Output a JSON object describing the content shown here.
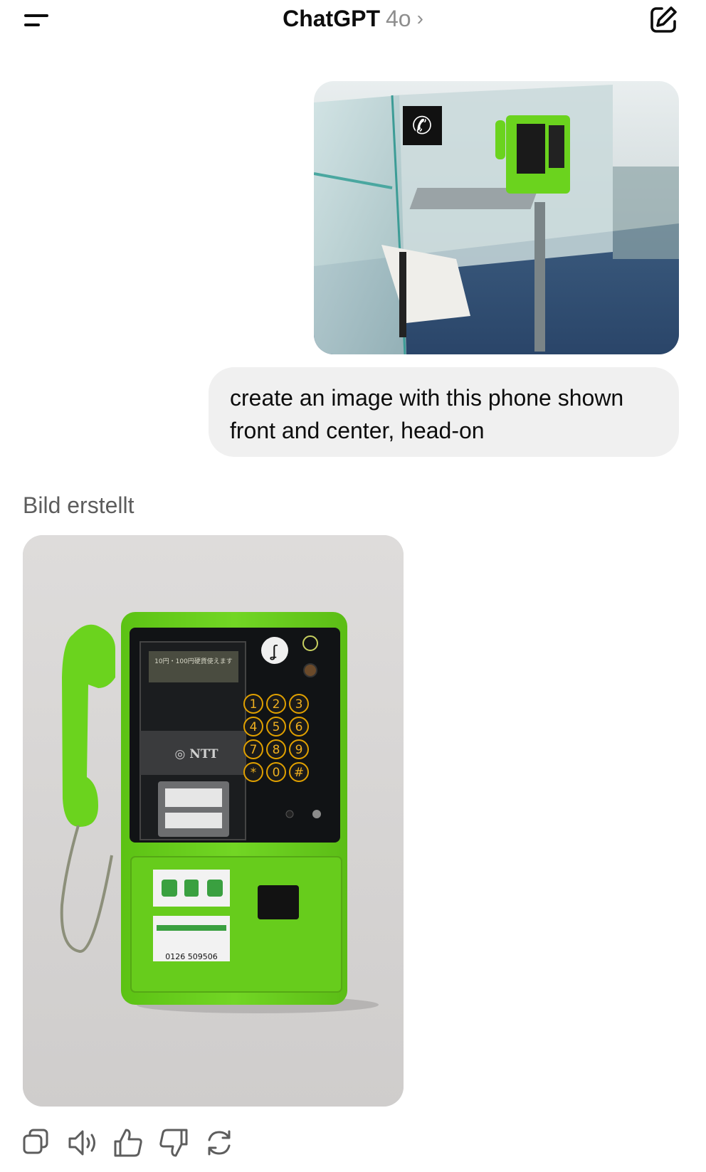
{
  "header": {
    "title": "ChatGPT",
    "model": "4o",
    "chevron": "›",
    "menu_icon": "menu-icon",
    "new_chat_icon": "new-chat-icon"
  },
  "conversation": {
    "user_image_alt_icon": "phone-booth-photo",
    "user_message": "create an image with this phone shown front and center, head-on",
    "assistant_label": "Bild erstellt",
    "phone_label": {
      "display_line": "10円・100円硬貨使えます",
      "brand": "NTT",
      "keys": [
        "1",
        "2",
        "3",
        "4",
        "5",
        "6",
        "7",
        "8",
        "9",
        "*",
        "0",
        "#"
      ],
      "phone_number": "0126 509506"
    }
  },
  "actions": [
    {
      "name": "copy-icon"
    },
    {
      "name": "read-aloud-icon"
    },
    {
      "name": "thumbs-up-icon"
    },
    {
      "name": "thumbs-down-icon"
    },
    {
      "name": "regenerate-icon"
    }
  ],
  "colors": {
    "phone_green": "#6bd31e",
    "bubble_bg": "#f0f0f0",
    "muted_text": "#8e8e8e"
  }
}
